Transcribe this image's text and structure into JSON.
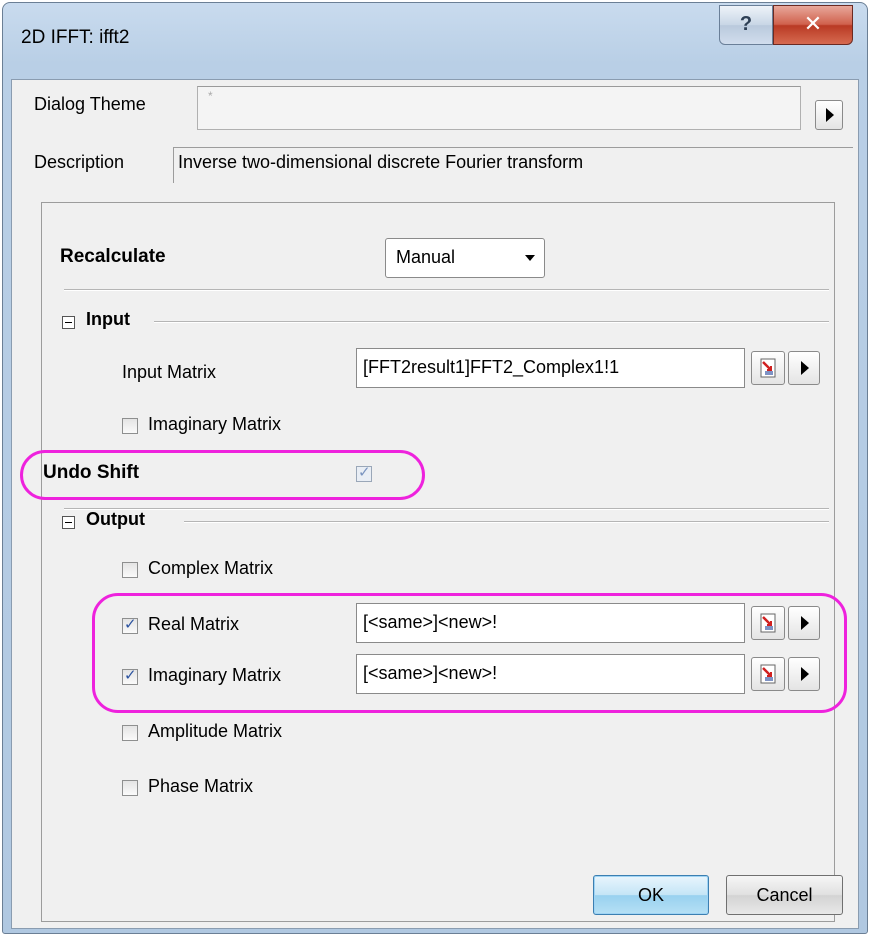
{
  "window": {
    "title": "2D IFFT: ifft2",
    "help_label": "?",
    "close_label": "✕"
  },
  "theme": {
    "label": "Dialog Theme",
    "value": "*"
  },
  "description": {
    "label": "Description",
    "text": "Inverse two-dimensional discrete Fourier transform"
  },
  "recalculate": {
    "label": "Recalculate",
    "value": "Manual"
  },
  "input": {
    "section_label": "Input",
    "input_matrix_label": "Input Matrix",
    "input_matrix_value": "[FFT2result1]FFT2_Complex1!1",
    "imaginary_label": "Imaginary Matrix",
    "imaginary_checked": false
  },
  "undo_shift": {
    "label": "Undo Shift",
    "checked": true
  },
  "output": {
    "section_label": "Output",
    "complex_label": "Complex Matrix",
    "real_label": "Real Matrix",
    "real_value": "[<same>]<new>!",
    "imaginary_label": "Imaginary Matrix",
    "imaginary_value": "[<same>]<new>!",
    "amplitude_label": "Amplitude Matrix",
    "phase_label": "Phase Matrix"
  },
  "buttons": {
    "ok": "OK",
    "cancel": "Cancel"
  },
  "colors": {
    "highlight": "#ee22dd",
    "title_bar": "#b9cfe6",
    "close_button": "#c7432b"
  },
  "icons": [
    "help-icon",
    "close-icon",
    "expand-arrow-icon",
    "dropdown-caret-icon",
    "collapse-toggle-icon",
    "range-picker-icon",
    "checkbox-icon"
  ]
}
